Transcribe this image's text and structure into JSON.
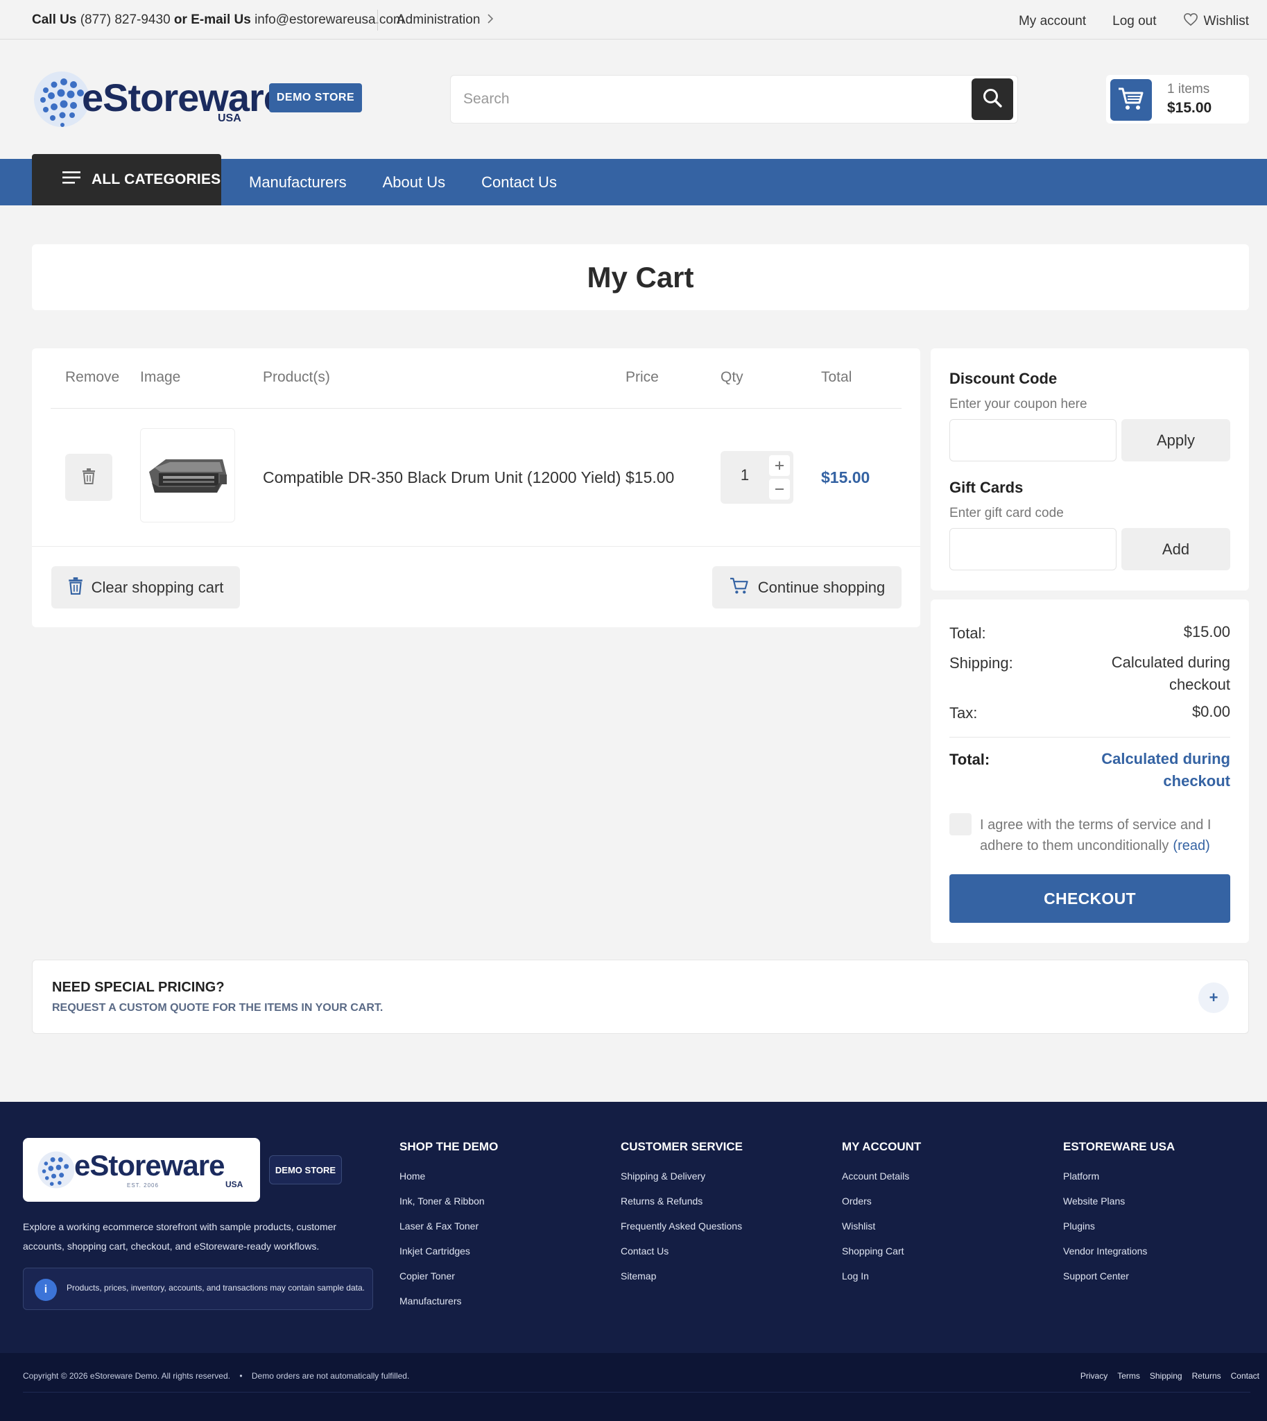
{
  "topbar": {
    "call_label": "Call Us",
    "phone": "(877) 827-9430",
    "or_text": "or",
    "email_label": "E-mail Us",
    "email": "info@estorewareusa.com",
    "admin": "Administration",
    "my_account": "My account",
    "log_out": "Log out",
    "wishlist": "Wishlist"
  },
  "header": {
    "logo_text": "eStoreware",
    "logo_sub": "USA",
    "logo_badge": "DEMO STORE",
    "search_placeholder": "Search",
    "cart_count": "1 items",
    "cart_amount": "$15.00"
  },
  "nav": {
    "all_categories": "ALL CATEGORIES",
    "links": [
      "Manufacturers",
      "About Us",
      "Contact Us"
    ]
  },
  "page_title": "My Cart",
  "cart_table": {
    "headers": [
      "Remove",
      "Image",
      "Product(s)",
      "Price",
      "Qty",
      "Total"
    ],
    "item": {
      "name": "Compatible DR-350 Black Drum Unit (12000 Yield)",
      "price": "$15.00",
      "qty": "1",
      "total": "$15.00"
    },
    "clear_label": "Clear shopping cart",
    "continue_label": "Continue shopping"
  },
  "discount": {
    "title": "Discount Code",
    "hint": "Enter your coupon here",
    "button": "Apply"
  },
  "gift": {
    "title": "Gift Cards",
    "hint": "Enter gift card code",
    "button": "Add"
  },
  "totals": {
    "total_label": "Total:",
    "total_value": "$15.00",
    "shipping_label": "Shipping:",
    "shipping_value_1": "Calculated during",
    "shipping_value_2": "checkout",
    "tax_label": "Tax:",
    "tax_value": "$0.00",
    "grand_label": "Total:",
    "grand_value_1": "Calculated during",
    "grand_value_2": "checkout",
    "terms_text": "I agree with the terms of service and I adhere to them unconditionally",
    "terms_link": "(read)",
    "checkout": "CHECKOUT"
  },
  "special": {
    "title": "NEED SPECIAL PRICING?",
    "subtitle": "REQUEST A CUSTOM QUOTE FOR THE ITEMS IN YOUR CART.",
    "plus": "+"
  },
  "footer": {
    "logo_text": "eStoreware",
    "logo_est": "EST. 2006",
    "logo_sub": "USA",
    "badge": "DEMO STORE",
    "description": "Explore a working ecommerce storefront with sample products, customer accounts, shopping cart, checkout, and eStoreware-ready workflows.",
    "note_icon": "i",
    "note": "Products, prices, inventory, accounts, and transactions may contain sample data.",
    "columns": [
      {
        "title": "SHOP THE DEMO",
        "items": [
          "Home",
          "Ink, Toner & Ribbon",
          "Laser & Fax Toner",
          "Inkjet Cartridges",
          "Copier Toner",
          "Manufacturers"
        ]
      },
      {
        "title": "CUSTOMER SERVICE",
        "items": [
          "Shipping & Delivery",
          "Returns & Refunds",
          "Frequently Asked Questions",
          "Contact Us",
          "Sitemap"
        ]
      },
      {
        "title": "MY ACCOUNT",
        "items": [
          "Account Details",
          "Orders",
          "Wishlist",
          "Shopping Cart",
          "Log In"
        ]
      },
      {
        "title": "ESTOREWARE USA",
        "items": [
          "Platform",
          "Website Plans",
          "Plugins",
          "Vendor Integrations",
          "Support Center"
        ]
      }
    ],
    "copyright": "Copyright © 2026 eStoreware Demo. All rights reserved.",
    "bullet": "•",
    "demo_notice": "Demo orders are not automatically fulfilled.",
    "bottom_links": [
      "Privacy",
      "Terms",
      "Shipping",
      "Returns",
      "Contact"
    ]
  },
  "colors": {
    "brand_blue": "#3563a3",
    "dark": "#2b2b2b",
    "footer_navy": "#141e44"
  },
  "icons": {
    "wishlist": "heart-icon",
    "search": "magnifier-icon",
    "cart": "cart-icon",
    "menu": "hamburger-icon",
    "remove": "trash-icon",
    "admin_chevron": "chevron-right-icon"
  }
}
